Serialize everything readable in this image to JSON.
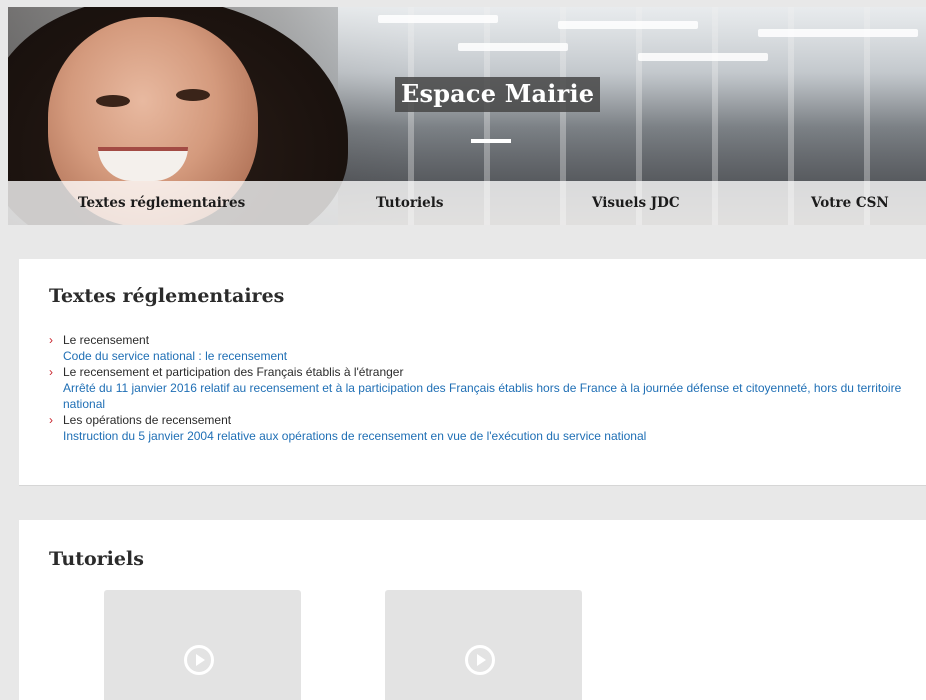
{
  "hero": {
    "title": "Espace Mairie"
  },
  "nav": {
    "items": [
      {
        "label": "Textes réglementaires"
      },
      {
        "label": "Tutoriels"
      },
      {
        "label": "Visuels JDC"
      },
      {
        "label": "Votre CSN"
      }
    ]
  },
  "textes_section": {
    "title": "Textes réglementaires",
    "items": [
      {
        "label": "Le recensement",
        "link": "Code du service national : le recensement"
      },
      {
        "label": "Le recensement et participation des Français établis à l'étranger",
        "link": "Arrêté du 11 janvier 2016 relatif au recensement et à la participation des Français établis hors de France à la journée défense et citoyenneté, hors du territoire national"
      },
      {
        "label": "Les opérations de recensement",
        "link": "Instruction du 5 janvier 2004 relative aux opérations de recensement en vue de l'exécution du service national"
      }
    ]
  },
  "tutoriels_section": {
    "title": "Tutoriels"
  },
  "icons": {
    "chevron": "chevron-right-icon",
    "play": "play-icon"
  },
  "colors": {
    "accent_red": "#c8232c",
    "link_blue": "#1f6fb5",
    "background": "#e8e8e8"
  }
}
